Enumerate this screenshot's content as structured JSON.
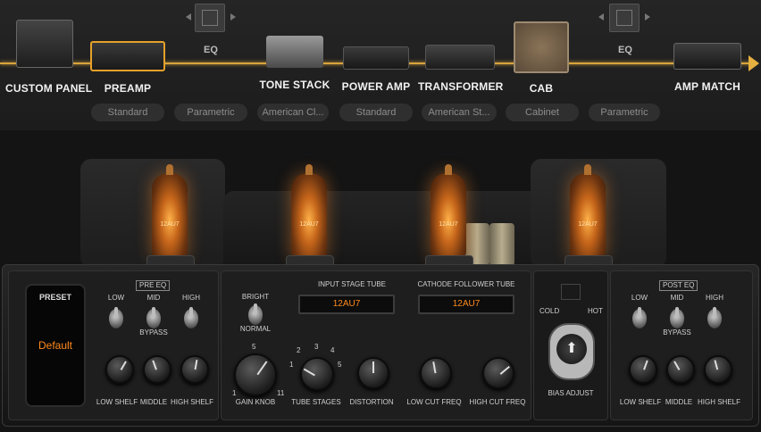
{
  "chain": {
    "modules": [
      {
        "label": "CUSTOM PANEL",
        "pill": ""
      },
      {
        "label": "PREAMP",
        "pill": "Standard"
      },
      {
        "label": "EQ",
        "pill": "Parametric"
      },
      {
        "label": "TONE STACK",
        "pill": "American Cl..."
      },
      {
        "label": "POWER AMP",
        "pill": "Standard"
      },
      {
        "label": "TRANSFORMER",
        "pill": "American St..."
      },
      {
        "label": "CAB",
        "pill": "Cabinet"
      },
      {
        "label": "EQ",
        "pill": "Parametric"
      },
      {
        "label": "AMP MATCH",
        "pill": ""
      }
    ],
    "accent": "#e6b040"
  },
  "tubes": [
    "12AU7",
    "12AU7",
    "12AU7",
    "12AU7"
  ],
  "panel": {
    "preset": {
      "title": "PRESET",
      "value": "Default",
      "value_color": "#ff8a1c"
    },
    "pre_eq": {
      "title": "PRE EQ",
      "toggles": [
        "LOW",
        "MID",
        "HIGH"
      ],
      "bypass": "BYPASS",
      "knobs": [
        "LOW SHELF",
        "MIDDLE",
        "HIGH SHELF"
      ]
    },
    "gain": {
      "bright": "BRIGHT",
      "normal": "NORMAL",
      "knob": "GAIN KNOB",
      "scale": [
        "1",
        "5",
        "11"
      ]
    },
    "tube_stages": {
      "label": "TUBE STAGES",
      "scale": [
        "1",
        "2",
        "3",
        "4",
        "5"
      ]
    },
    "input_stage": {
      "title": "INPUT STAGE TUBE",
      "value": "12AU7"
    },
    "cathode": {
      "title": "CATHODE FOLLOWER TUBE",
      "value": "12AU7"
    },
    "mid_knobs": [
      "DISTORTION",
      "LOW CUT FREQ",
      "HIGH CUT FREQ"
    ],
    "bias": {
      "cold": "COLD",
      "hot": "HOT",
      "label": "BIAS ADJUST"
    },
    "post_eq": {
      "title": "POST EQ",
      "toggles": [
        "LOW",
        "MID",
        "HIGH"
      ],
      "bypass": "BYPASS",
      "knobs": [
        "LOW SHELF",
        "MIDDLE",
        "HIGH SHELF"
      ]
    }
  }
}
